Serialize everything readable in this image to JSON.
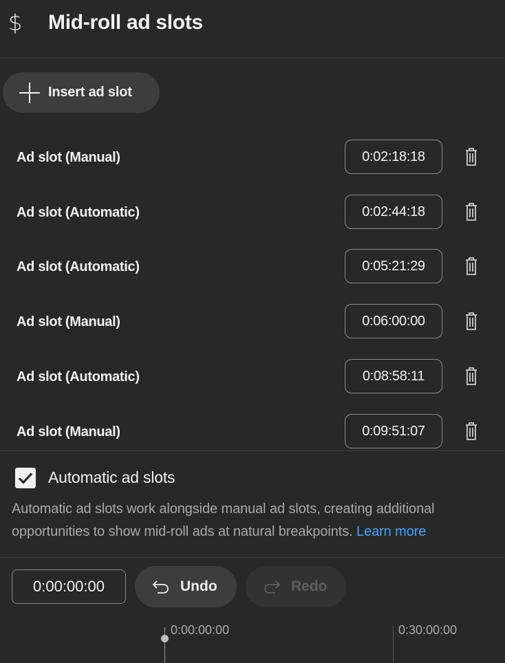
{
  "header": {
    "icon": "dollar-icon",
    "title": "Mid-roll ad slots"
  },
  "insert_button": {
    "icon": "plus-icon",
    "label": "Insert ad slot"
  },
  "slots": [
    {
      "name": "Ad slot (Manual)",
      "time": "0:02:18:18"
    },
    {
      "name": "Ad slot (Automatic)",
      "time": "0:02:44:18"
    },
    {
      "name": "Ad slot (Automatic)",
      "time": "0:05:21:29"
    },
    {
      "name": "Ad slot (Manual)",
      "time": "0:06:00:00"
    },
    {
      "name": "Ad slot (Automatic)",
      "time": "0:08:58:11"
    },
    {
      "name": "Ad slot (Manual)",
      "time": "0:09:51:07"
    }
  ],
  "automatic": {
    "checked": true,
    "label": "Automatic ad slots",
    "description": "Automatic ad slots work alongside manual ad slots, creating additional opportunities to show mid-roll ads at natural breakpoints.",
    "learn_more": "Learn more"
  },
  "toolbar": {
    "time_value": "0:00:00:00",
    "undo_label": "Undo",
    "redo_label": "Redo",
    "redo_enabled": false
  },
  "timeline": {
    "start_label": "0:00:00:00",
    "end_label": "0:30:00:00"
  },
  "colors": {
    "background": "#282828",
    "link": "#3ea6ff",
    "text": "#f1f1f1",
    "muted": "#aaaaaa"
  }
}
